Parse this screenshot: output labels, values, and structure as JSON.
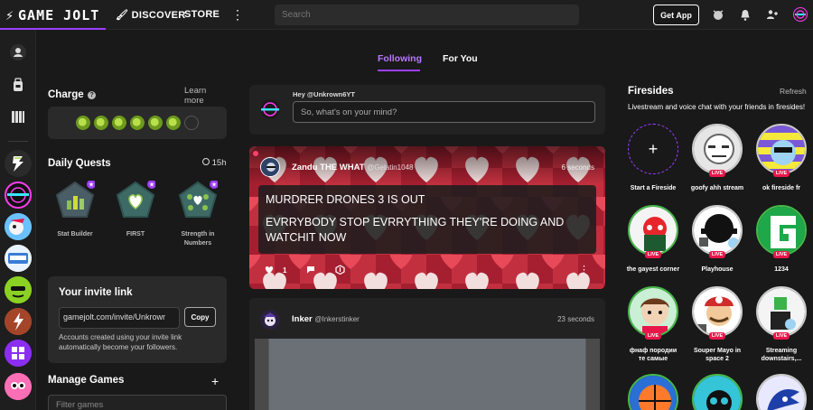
{
  "topbar": {
    "logo_text": "GAME JOLT",
    "discover": "DISCOVER",
    "store": "STORE",
    "search_placeholder": "Search",
    "get_app": "Get App"
  },
  "feed_tabs": {
    "following": "Following",
    "for_you": "For You"
  },
  "left": {
    "charge_title": "Charge",
    "learn_more": "Learn more",
    "charge_filled": 6,
    "charge_total": 7,
    "daily_quests_title": "Daily Quests",
    "quests_timer": "15h",
    "quests": [
      {
        "label": "Stat Builder"
      },
      {
        "label": "FIRST"
      },
      {
        "label": "Strength in Numbers"
      }
    ],
    "invite_title": "Your invite link",
    "invite_value": "gamejolt.com/invite/Unkrowr",
    "copy_label": "Copy",
    "invite_desc": "Accounts created using your invite link automatically become your followers.",
    "manage_games_title": "Manage Games",
    "filter_placeholder": "Filter games"
  },
  "composer": {
    "greeting": "Hey @Unkrown6YT",
    "placeholder": "So, what's on your mind?"
  },
  "posts": [
    {
      "author": "Zandu THE WHAT",
      "handle": "@Gelatin1048",
      "time": "6 seconds",
      "line1": "MURDRER DRONES 3 IS OUT",
      "line2": "EVRRYBODY STOP EVRRYTHING THEY'RE DOING AND WATCHIT NOW",
      "likes": "1"
    },
    {
      "author": "Inker",
      "handle": "@Inkerstinker",
      "time": "23 seconds"
    }
  ],
  "firesides": {
    "title": "Firesides",
    "refresh": "Refresh",
    "desc": "Livestream and voice chat with your friends in firesides!",
    "live_label": "LIVE",
    "start": "Start a Fireside",
    "items": [
      {
        "label": "goofy ahh stream"
      },
      {
        "label": "ok fireside fr"
      },
      {
        "label": "the gayest corner"
      },
      {
        "label": "Playhouse"
      },
      {
        "label": "1234"
      },
      {
        "label": "фнаф породии те самые"
      },
      {
        "label": "Souper Mayo in space 2"
      },
      {
        "label": "Streaming downstairs,..."
      }
    ]
  },
  "colors": {
    "accent": "#9c3fff",
    "live": "#e8174b",
    "charge": "#8fc31f",
    "bg": "#191919"
  }
}
